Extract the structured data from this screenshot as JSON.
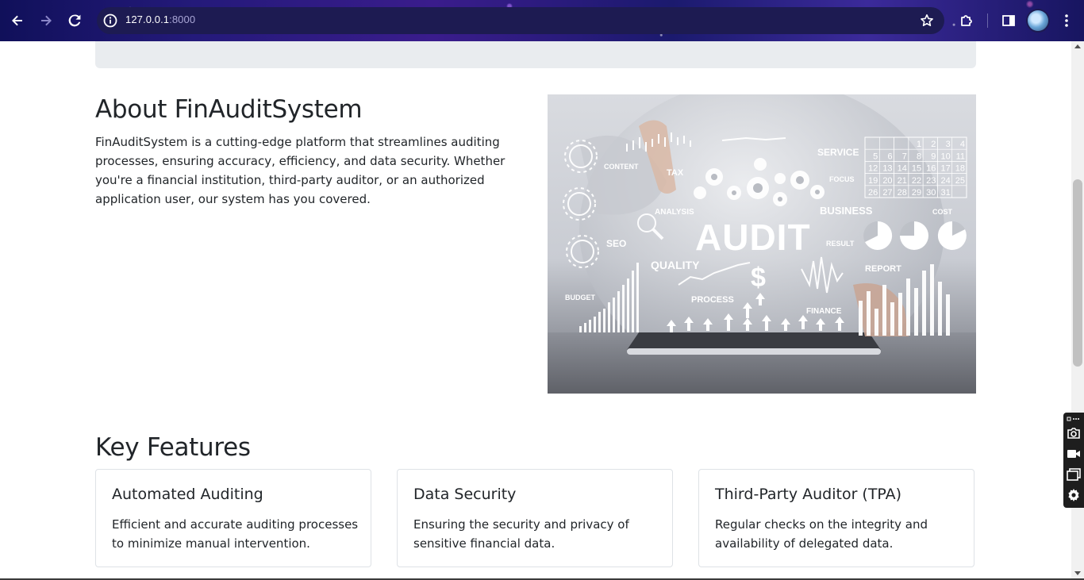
{
  "browser": {
    "url_host": "127.0.0.1",
    "url_port": ":8000",
    "icons": {
      "back": "arrow-left-icon",
      "forward": "arrow-right-icon",
      "reload": "reload-icon",
      "site_info": "site-info-icon",
      "bookmark": "star-icon",
      "extensions": "puzzle-icon",
      "side_panel": "side-panel-icon",
      "menu": "kebab-menu-icon"
    }
  },
  "about": {
    "title": "About FinAuditSystem",
    "text": "FinAuditSystem is a cutting-edge platform that streamlines auditing processes, ensuring accuracy, efficiency, and data security. Whether you're a financial institution, third-party auditor, or an authorized application user, our system has you covered."
  },
  "hero_image": {
    "labels": {
      "audit": "AUDIT",
      "service": "SERVICE",
      "content": "CONTENT",
      "tax": "TAX",
      "focus": "FOCUS",
      "analysis": "ANALYSIS",
      "business": "BUSINESS",
      "cost": "COST",
      "seo": "SEO",
      "result": "RESULT",
      "quality": "QUALITY",
      "report": "REPORT",
      "budget": "BUDGET",
      "process": "PROCESS",
      "finance": "FINANCE",
      "dollar": "$"
    },
    "calendar": [
      [
        "",
        "",
        "",
        "1",
        "2",
        "3",
        "4"
      ],
      [
        "5",
        "6",
        "7",
        "8",
        "9",
        "10",
        "11"
      ],
      [
        "12",
        "13",
        "14",
        "15",
        "16",
        "17",
        "18"
      ],
      [
        "19",
        "20",
        "21",
        "22",
        "23",
        "24",
        "25"
      ],
      [
        "26",
        "27",
        "28",
        "29",
        "30",
        "31",
        ""
      ]
    ]
  },
  "features": {
    "title": "Key Features",
    "cards": [
      {
        "title": "Automated Auditing",
        "text": "Efficient and accurate auditing processes to minimize manual intervention."
      },
      {
        "title": "Data Security",
        "text": "Ensuring the security and privacy of sensitive financial data."
      },
      {
        "title": "Third-Party Auditor (TPA)",
        "text": "Regular checks on the integrity and availability of delegated data."
      }
    ]
  },
  "capture_toolbar": {
    "icons": [
      "camera-icon",
      "video-icon",
      "window-icon",
      "settings-icon"
    ]
  }
}
